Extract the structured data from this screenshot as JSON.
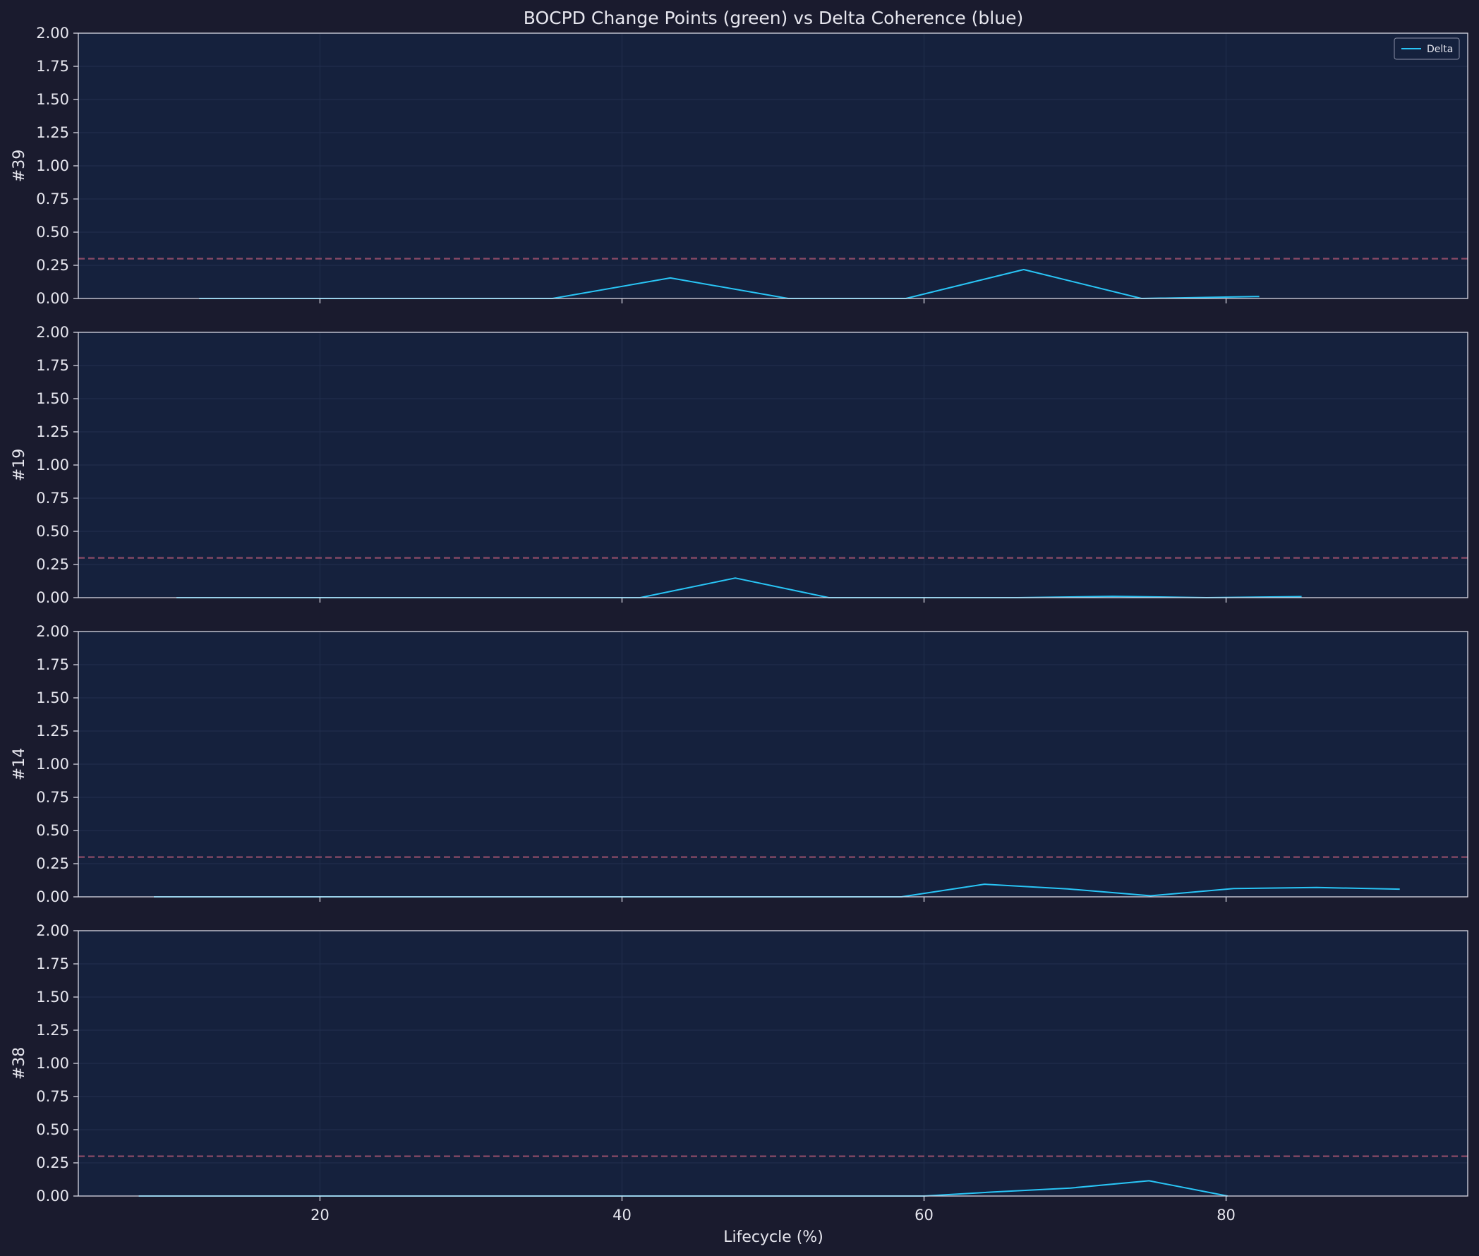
{
  "chart_data": {
    "type": "line",
    "title": "BOCPD Change Points (green) vs Delta Coherence (blue)",
    "xlabel": "Lifecycle (%)",
    "xlim": [
      4,
      96
    ],
    "xticks": [
      20,
      40,
      60,
      80
    ],
    "ylim": [
      0,
      2
    ],
    "yticks": [
      0,
      0.25,
      0.5,
      0.75,
      1,
      1.25,
      1.5,
      1.75,
      2
    ],
    "grid": true,
    "legend": {
      "placement": "top-right",
      "entries": [
        "Delta"
      ]
    },
    "threshold": {
      "value": 0.3,
      "style": "dashed",
      "color": "#8a4a66"
    },
    "colors": {
      "background": "#1a1b2e",
      "axes_face": "#15213d",
      "delta_line": "#29c5f6",
      "threshold": "#8a4a66",
      "text": "#e6e6ee",
      "spine": "#d8d8e4",
      "grid": "#22304e"
    },
    "panels": [
      {
        "ylabel": "#39",
        "series": [
          {
            "name": "Delta",
            "x": [
              12,
              20,
              28,
              35.4,
              43.2,
              51,
              58.8,
              66.6,
              74.4,
              82.2
            ],
            "y": [
              0,
              0,
              0,
              0,
              0.155,
              0,
              0,
              0.218,
              0,
              0.015
            ]
          }
        ]
      },
      {
        "ylabel": "#19",
        "series": [
          {
            "name": "Delta",
            "x": [
              10.5,
              23,
              35,
              41.2,
              47.5,
              53.7,
              60,
              66.2,
              72.5,
              78.7,
              85
            ],
            "y": [
              0,
              0,
              0,
              0,
              0.148,
              0,
              0,
              0,
              0.01,
              0,
              0.008
            ]
          }
        ]
      },
      {
        "ylabel": "#14",
        "series": [
          {
            "name": "Delta",
            "x": [
              9,
              25,
              40,
              58.5,
              64,
              69.5,
              75,
              80.5,
              86,
              91.5
            ],
            "y": [
              0,
              0,
              0,
              0,
              0.095,
              0.06,
              0.008,
              0.062,
              0.07,
              0.058
            ]
          }
        ]
      },
      {
        "ylabel": "#38",
        "series": [
          {
            "name": "Delta",
            "x": [
              8,
              25,
              45,
              60,
              64.5,
              69.7,
              74.9,
              80.1
            ],
            "y": [
              0,
              0,
              0,
              0,
              0.03,
              0.06,
              0.115,
              0
            ]
          }
        ]
      }
    ]
  }
}
